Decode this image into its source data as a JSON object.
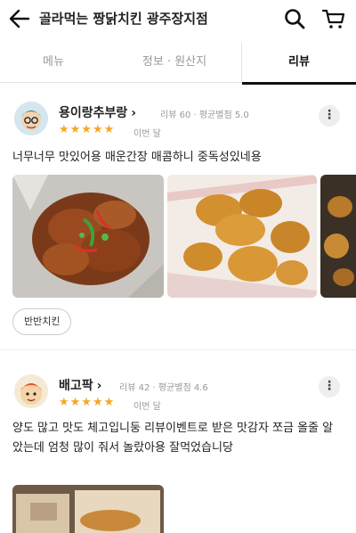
{
  "header": {
    "title": "골라먹는 짱닭치킨 광주장지점"
  },
  "tabs": [
    {
      "label": "메뉴"
    },
    {
      "label": "정보 · 원산지"
    },
    {
      "label": "리뷰"
    }
  ],
  "reviews": [
    {
      "nickname": "용이랑추부랑",
      "meta": "리뷰 60 · 평균별점 5.0",
      "stars": "★★★★★",
      "when": "이번 달",
      "text": "너무너무 맛있어용 매운간장 매콤하니 중독성있네용",
      "tag": "반반치킨"
    },
    {
      "nickname": "배고팍",
      "meta": "리뷰 42 · 평균별점 4.6",
      "stars": "★★★★★",
      "when": "이번 달",
      "text": "양도 많고 맛도 체고입니둥 리뷰이벤트로 받은 맛감자 쪼금 올줄 알았는데 엄청 많이 줘서 놀랐아용 잘먹었습니당"
    }
  ],
  "colors": {
    "star": "#f5a623",
    "active_tab": "#111111",
    "muted": "#999999"
  },
  "icons": [
    "back-arrow-icon",
    "search-icon",
    "cart-icon",
    "more-options-icon"
  ]
}
